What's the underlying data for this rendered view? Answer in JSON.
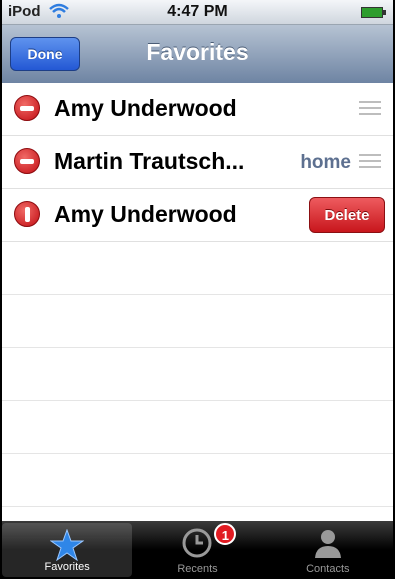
{
  "status_bar": {
    "carrier": "iPod",
    "time": "4:47 PM"
  },
  "nav": {
    "done_label": "Done",
    "title": "Favorites"
  },
  "favorites": [
    {
      "name": "Amy Underwood",
      "label": ""
    },
    {
      "name": "Martin Trautsch...",
      "label": "home"
    },
    {
      "name": "Amy Underwood",
      "delete_label": "Delete"
    }
  ],
  "tabs": [
    {
      "label": "Favorites",
      "icon": "star-icon",
      "active": true
    },
    {
      "label": "Recents",
      "icon": "clock-icon",
      "badge": "1"
    },
    {
      "label": "Contacts",
      "icon": "person-icon"
    }
  ],
  "colors": {
    "nav_gradient_top": "#b6c3d3",
    "nav_gradient_bottom": "#6e84a3",
    "done_blue": "#2358d4",
    "delete_red": "#c8161c",
    "active_tab": "#2f86e8"
  }
}
